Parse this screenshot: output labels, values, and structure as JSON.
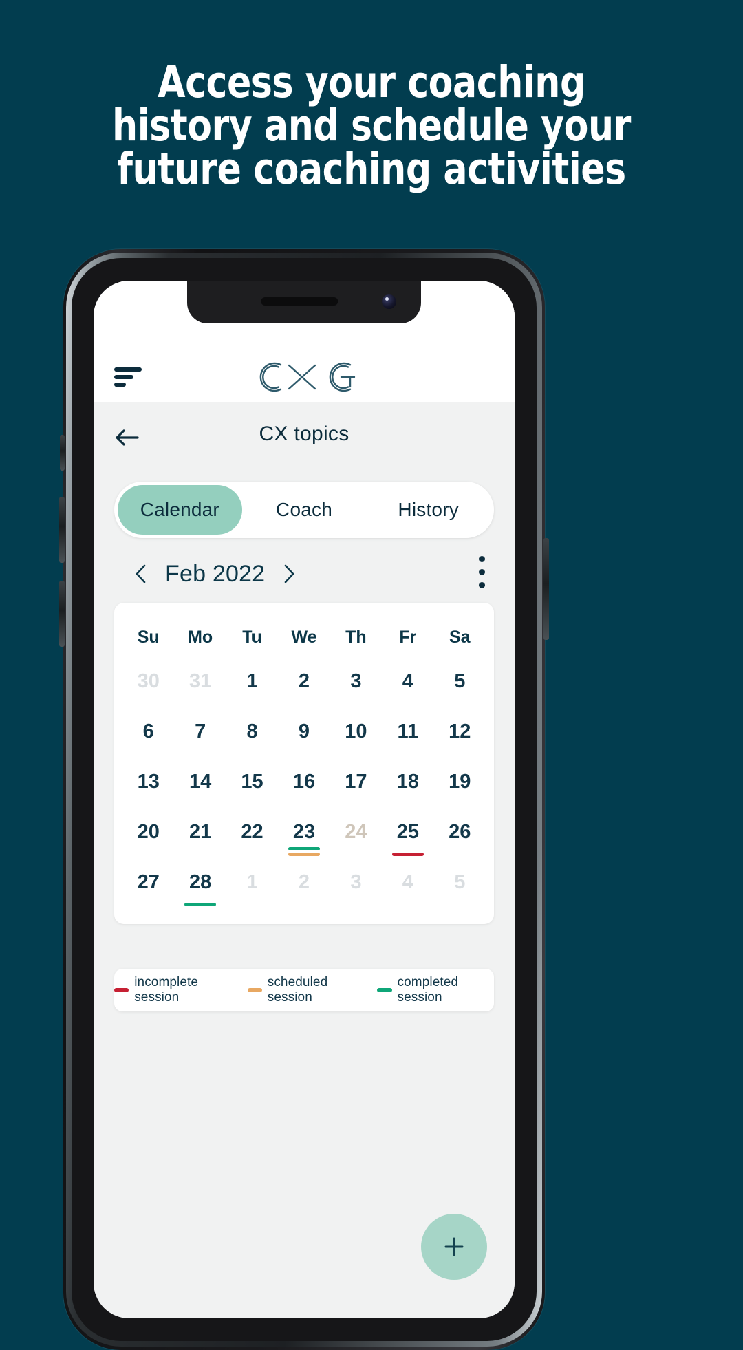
{
  "theme": {
    "background": "#023d4f",
    "accent_mint": "#94cfbe",
    "fab_mint": "#a6d5c7",
    "text_dark": "#0c2c3c",
    "status_incomplete": "#c62033",
    "status_scheduled": "#e8a862",
    "status_completed": "#0fa678"
  },
  "headline": {
    "line1": "Access your coaching",
    "line2": "history and schedule your",
    "line3": "future coaching activities"
  },
  "app": {
    "menu_icon": "hamburger-icon",
    "logo_text": "CXG",
    "back_icon": "back-arrow-icon",
    "screen_title": "CX topics",
    "more_icon": "kebab-menu-icon",
    "tabs": [
      {
        "label": "Calendar",
        "active": true
      },
      {
        "label": "Coach",
        "active": false
      },
      {
        "label": "History",
        "active": false
      }
    ],
    "calendar": {
      "prev_icon": "chevron-left-icon",
      "next_icon": "chevron-right-icon",
      "month_label": "Feb 2022",
      "weekdays": [
        "Su",
        "Mo",
        "Tu",
        "We",
        "Th",
        "Fr",
        "Sa"
      ],
      "weeks": [
        [
          {
            "day": "30",
            "state": "muted",
            "marks": []
          },
          {
            "day": "31",
            "state": "muted",
            "marks": []
          },
          {
            "day": "1",
            "state": "normal",
            "marks": []
          },
          {
            "day": "2",
            "state": "normal",
            "marks": []
          },
          {
            "day": "3",
            "state": "normal",
            "marks": []
          },
          {
            "day": "4",
            "state": "normal",
            "marks": []
          },
          {
            "day": "5",
            "state": "normal",
            "marks": []
          }
        ],
        [
          {
            "day": "6",
            "state": "normal",
            "marks": []
          },
          {
            "day": "7",
            "state": "normal",
            "marks": []
          },
          {
            "day": "8",
            "state": "normal",
            "marks": []
          },
          {
            "day": "9",
            "state": "normal",
            "marks": []
          },
          {
            "day": "10",
            "state": "normal",
            "marks": []
          },
          {
            "day": "11",
            "state": "normal",
            "marks": []
          },
          {
            "day": "12",
            "state": "normal",
            "marks": []
          }
        ],
        [
          {
            "day": "13",
            "state": "normal",
            "marks": []
          },
          {
            "day": "14",
            "state": "normal",
            "marks": []
          },
          {
            "day": "15",
            "state": "normal",
            "marks": []
          },
          {
            "day": "16",
            "state": "normal",
            "marks": []
          },
          {
            "day": "17",
            "state": "normal",
            "marks": []
          },
          {
            "day": "18",
            "state": "normal",
            "marks": []
          },
          {
            "day": "19",
            "state": "normal",
            "marks": []
          }
        ],
        [
          {
            "day": "20",
            "state": "normal",
            "marks": []
          },
          {
            "day": "21",
            "state": "normal",
            "marks": []
          },
          {
            "day": "22",
            "state": "normal",
            "marks": []
          },
          {
            "day": "23",
            "state": "normal",
            "marks": [
              "completed",
              "scheduled"
            ]
          },
          {
            "day": "24",
            "state": "holiday",
            "marks": []
          },
          {
            "day": "25",
            "state": "normal",
            "marks": [
              "incomplete"
            ]
          },
          {
            "day": "26",
            "state": "normal",
            "marks": []
          }
        ],
        [
          {
            "day": "27",
            "state": "normal",
            "marks": []
          },
          {
            "day": "28",
            "state": "normal",
            "marks": [
              "completed"
            ]
          },
          {
            "day": "1",
            "state": "muted",
            "marks": []
          },
          {
            "day": "2",
            "state": "muted",
            "marks": []
          },
          {
            "day": "3",
            "state": "muted",
            "marks": []
          },
          {
            "day": "4",
            "state": "muted",
            "marks": []
          },
          {
            "day": "5",
            "state": "muted",
            "marks": []
          }
        ]
      ]
    },
    "legend": [
      {
        "label": "incomplete session",
        "color": "#c62033"
      },
      {
        "label": "scheduled session",
        "color": "#e8a862"
      },
      {
        "label": "completed session",
        "color": "#0fa678"
      }
    ],
    "fab": {
      "icon": "plus-icon",
      "label": "+"
    }
  }
}
